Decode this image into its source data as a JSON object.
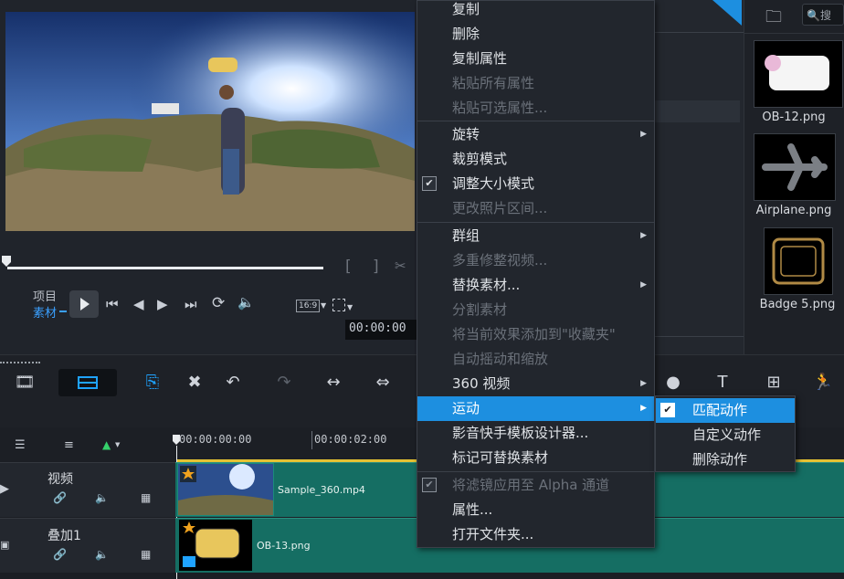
{
  "preview": {
    "mode_project": "项目",
    "mode_clip": "素材",
    "aspect_ratio": "16:9",
    "timecode": "00:00:00",
    "mark_in": "[",
    "mark_out": "]"
  },
  "library": {
    "search_placeholder": "搜",
    "items": [
      {
        "name": "OB-12.png"
      },
      {
        "name": "Airplane.png"
      },
      {
        "name": "Badge 5.png"
      }
    ]
  },
  "timeline": {
    "ruler": [
      "00:00:00:00",
      "00:00:02:00"
    ],
    "tracks": [
      {
        "name": "视频",
        "clip": "Sample_360.mp4"
      },
      {
        "name": "叠加1",
        "clip": "OB-13.png"
      }
    ]
  },
  "context_menu": {
    "items": [
      {
        "label": "复制"
      },
      {
        "label": "删除"
      },
      {
        "label": "复制属性"
      },
      {
        "label": "粘贴所有属性"
      },
      {
        "label": "粘贴可选属性..."
      },
      {
        "label": "旋转"
      },
      {
        "label": "裁剪模式"
      },
      {
        "label": "调整大小模式"
      },
      {
        "label": "更改照片区间..."
      },
      {
        "label": "群组"
      },
      {
        "label": "多重修整视频..."
      },
      {
        "label": "替换素材..."
      },
      {
        "label": "分割素材"
      },
      {
        "label": "将当前效果添加到\"收藏夹\""
      },
      {
        "label": "自动摇动和缩放"
      },
      {
        "label": "360 视频"
      },
      {
        "label": "运动"
      },
      {
        "label": "影音快手模板设计器..."
      },
      {
        "label": "标记可替换素材"
      },
      {
        "label": "将滤镜应用至 Alpha 通道"
      },
      {
        "label": "属性..."
      },
      {
        "label": "打开文件夹..."
      }
    ]
  },
  "submenu": {
    "items": [
      {
        "label": "匹配动作"
      },
      {
        "label": "自定义动作"
      },
      {
        "label": "删除动作"
      }
    ]
  },
  "colors": {
    "highlight": "#1d8fe0",
    "track": "#156e63",
    "accent": "#1fa3ff"
  }
}
